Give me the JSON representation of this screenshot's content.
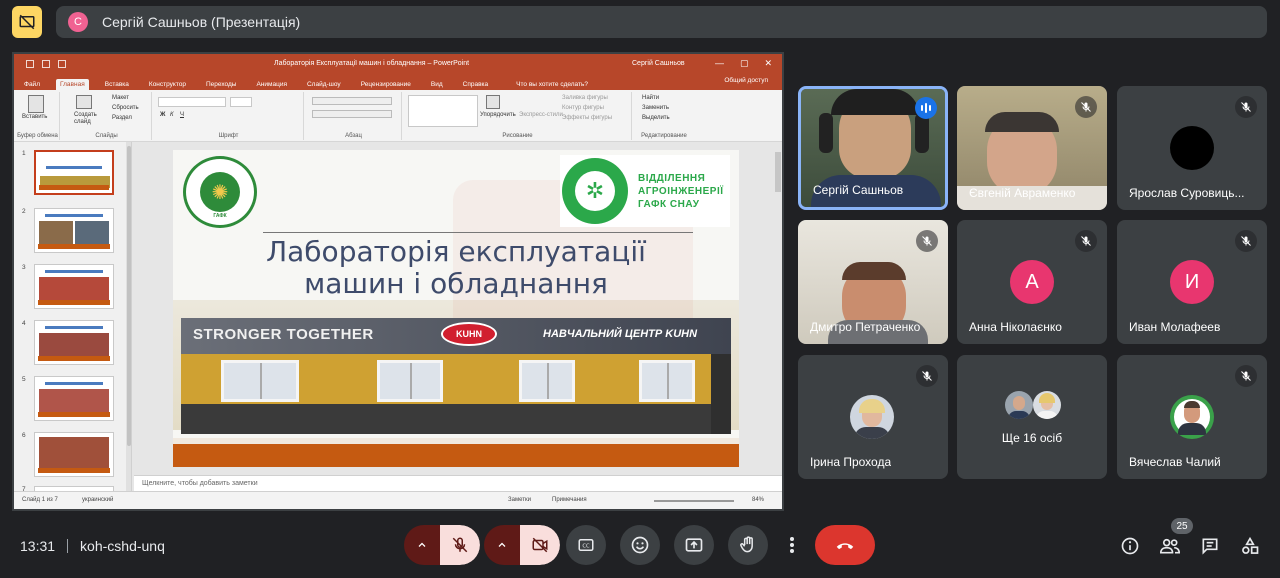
{
  "presenter": {
    "initial": "С",
    "title": "Сергій Сашньов (Презентація)"
  },
  "powerpoint": {
    "doc_title": "Лабораторія Експлуатації машин і обладнання – PowerPoint",
    "user": "Сергій Сашньов",
    "tabs": [
      "Файл",
      "Главная",
      "Вставка",
      "Конструктор",
      "Переходы",
      "Анимация",
      "Слайд-шоу",
      "Рецензирование",
      "Вид",
      "Справка"
    ],
    "search": "Что вы хотите сделать?",
    "share": "Общий доступ",
    "ribbon": {
      "paste": "Вставить",
      "create_slide": "Создать слайд",
      "layout": "Макет",
      "reset": "Сбросить",
      "section": "Раздел",
      "arrange": "Упорядочить",
      "express": "Экспресс-стили",
      "fill": "Заливка фигуры",
      "outline": "Контур фигуры",
      "effects": "Эффекты фигуры",
      "find": "Найти",
      "replace": "Заменить",
      "select": "Выделить",
      "groups": [
        "Буфер обмена",
        "Слайды",
        "Шрифт",
        "Абзац",
        "Рисование",
        "Редактирование"
      ]
    },
    "thumbnails": [
      "1",
      "2",
      "3",
      "4",
      "5",
      "6",
      "7"
    ],
    "slide": {
      "title_line1": "Лабораторія експлуатації",
      "title_line2": "машин і обладнання",
      "logo_right_line1": "ВІДДІЛЕННЯ",
      "logo_right_line2": "АГРОІНЖЕНЕРІЇ",
      "logo_right_line3": "ГАФК СНАУ",
      "logo_left_label": "ГАФК",
      "banner_left": "STRONGER TOGETHER",
      "banner_logo": "KUHN",
      "banner_right": "НАВЧАЛЬНИЙ ЦЕНТР KUHN"
    },
    "notes_placeholder": "Щелкните, чтобы добавить заметки",
    "status": {
      "slide": "Слайд 1 из 7",
      "language": "украинский",
      "notes": "Заметки",
      "comments": "Примечания",
      "zoom": "84%"
    }
  },
  "participants": [
    {
      "name": "Сергій Сашньов",
      "type": "video",
      "speaking": true
    },
    {
      "name": "Євгеній Авраменко",
      "type": "video",
      "muted": true
    },
    {
      "name": "Ярослав Суровиць...",
      "type": "avatar-black",
      "muted": true
    },
    {
      "name": "Дмитро Петраченко",
      "type": "video",
      "muted": true
    },
    {
      "name": "Анна Ніколаєнко",
      "type": "letter",
      "letter": "А",
      "color": "#e8366f",
      "muted": true
    },
    {
      "name": "Иван Молафеев",
      "type": "letter",
      "letter": "И",
      "color": "#e8366f",
      "muted": true
    },
    {
      "name": "Ірина Прохода",
      "type": "photo",
      "muted": true
    },
    {
      "name": "Ще 16 осіб",
      "type": "more"
    },
    {
      "name": "Вячеслав Чалий",
      "type": "photo",
      "muted": true
    }
  ],
  "bottom": {
    "time": "13:31",
    "meeting_code": "koh-cshd-unq",
    "participant_count": "25"
  },
  "colors": {
    "end_call": "#dc362e",
    "mic_off_bg": "#f9dedc",
    "accent": "#8ab4f8",
    "powerpoint": "#b7472a"
  }
}
